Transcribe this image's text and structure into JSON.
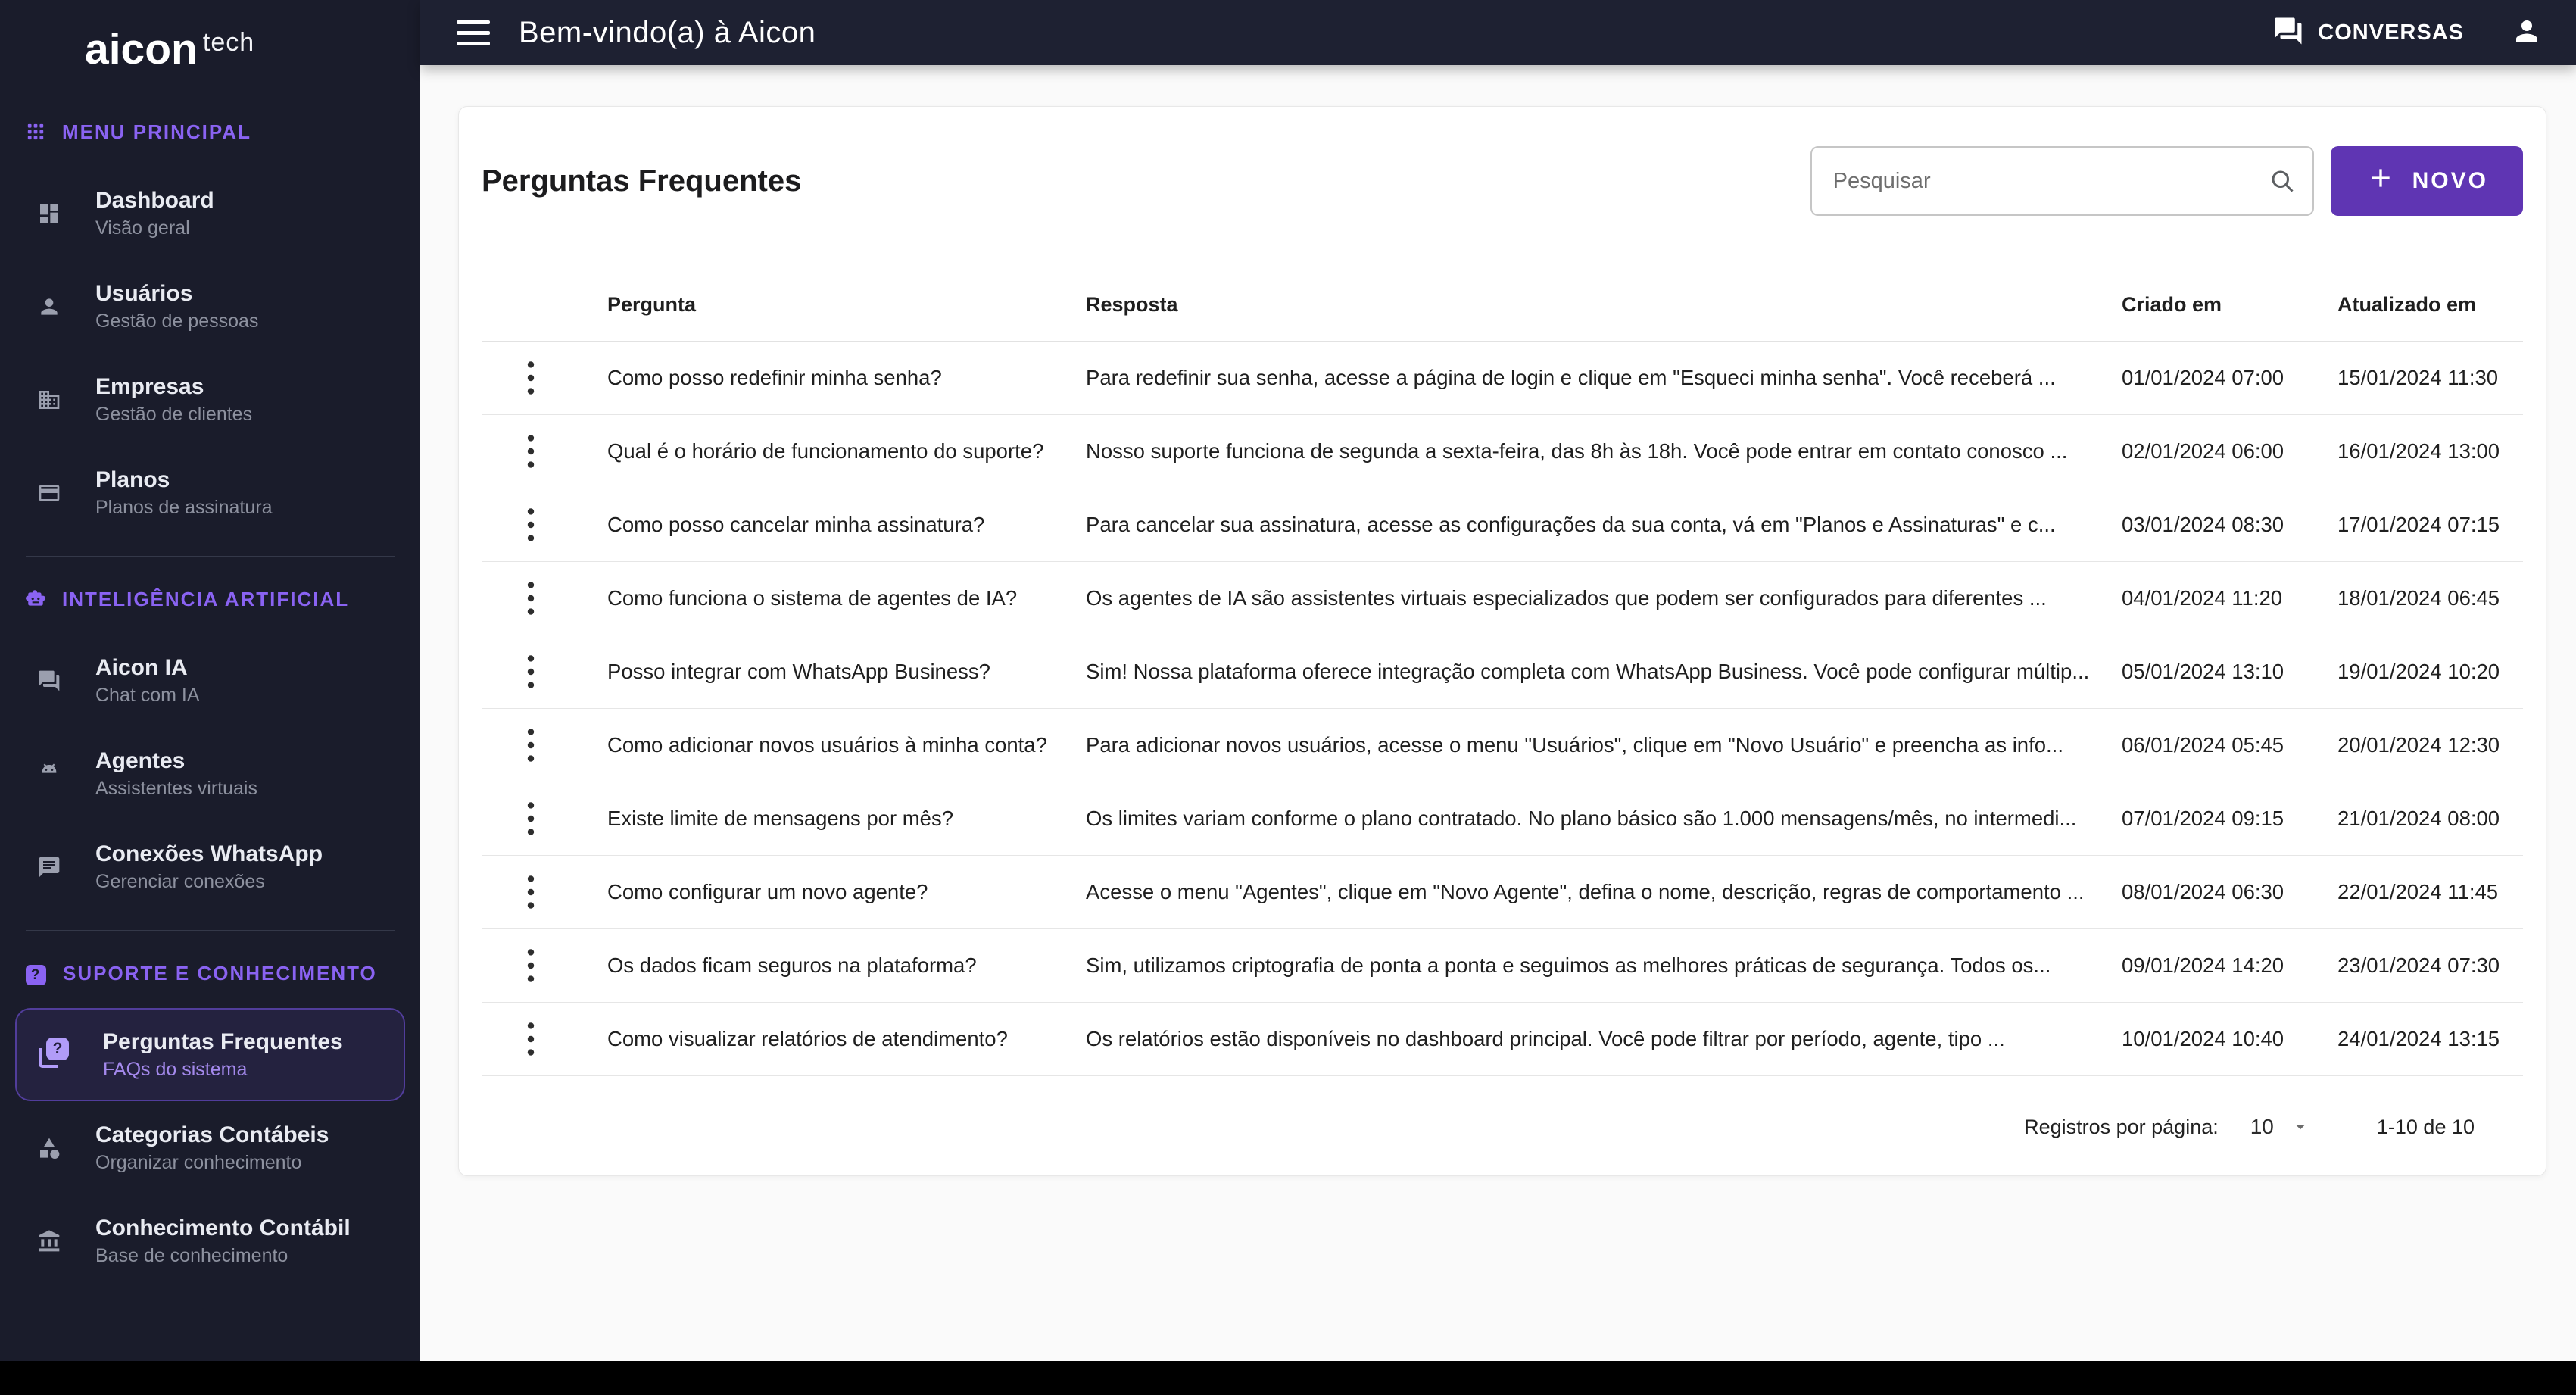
{
  "app": {
    "brand": "aicon",
    "brand_suffix": "tech"
  },
  "topbar": {
    "title": "Bem-vindo(a) à Aicon",
    "conversations_label": "CONVERSAS"
  },
  "sidebar": {
    "sections": [
      {
        "label": "MENU PRINCIPAL",
        "icon": "apps-grid-icon",
        "items": [
          {
            "label": "Dashboard",
            "sublabel": "Visão geral",
            "icon": "dashboard-icon",
            "active": false
          },
          {
            "label": "Usuários",
            "sublabel": "Gestão de pessoas",
            "icon": "person-icon",
            "active": false
          },
          {
            "label": "Empresas",
            "sublabel": "Gestão de clientes",
            "icon": "building-icon",
            "active": false
          },
          {
            "label": "Planos",
            "sublabel": "Planos de assinatura",
            "icon": "credit-card-icon",
            "active": false
          }
        ]
      },
      {
        "label": "INTELIGÊNCIA ARTIFICIAL",
        "icon": "robot-icon",
        "items": [
          {
            "label": "Aicon IA",
            "sublabel": "Chat com IA",
            "icon": "forum-icon",
            "active": false
          },
          {
            "label": "Agentes",
            "sublabel": "Assistentes virtuais",
            "icon": "robot-head-icon",
            "active": false
          },
          {
            "label": "Conexões WhatsApp",
            "sublabel": "Gerenciar conexões",
            "icon": "chat-lines-icon",
            "active": false
          }
        ]
      },
      {
        "label": "SUPORTE E CONHECIMENTO",
        "icon": "question-square-icon",
        "items": [
          {
            "label": "Perguntas Frequentes",
            "sublabel": "FAQs do sistema",
            "icon": "quiz-icon",
            "active": true
          },
          {
            "label": "Categorias Contábeis",
            "sublabel": "Organizar conhecimento",
            "icon": "category-icon",
            "active": false
          },
          {
            "label": "Conhecimento Contábil",
            "sublabel": "Base de conhecimento",
            "icon": "bank-icon",
            "active": false
          }
        ]
      }
    ]
  },
  "main": {
    "page_title": "Perguntas Frequentes",
    "search": {
      "placeholder": "Pesquisar"
    },
    "new_button_label": "NOVO",
    "table": {
      "columns": [
        "",
        "Pergunta",
        "Resposta",
        "Criado em",
        "Atualizado em"
      ],
      "rows": [
        {
          "question": "Como posso redefinir minha senha?",
          "answer": "Para redefinir sua senha, acesse a página de login e clique em \"Esqueci minha senha\". Você receberá ...",
          "created": "01/01/2024 07:00",
          "updated": "15/01/2024 11:30"
        },
        {
          "question": "Qual é o horário de funcionamento do suporte?",
          "answer": "Nosso suporte funciona de segunda a sexta-feira, das 8h às 18h. Você pode entrar em contato conosco ...",
          "created": "02/01/2024 06:00",
          "updated": "16/01/2024 13:00"
        },
        {
          "question": "Como posso cancelar minha assinatura?",
          "answer": "Para cancelar sua assinatura, acesse as configurações da sua conta, vá em \"Planos e Assinaturas\" e c...",
          "created": "03/01/2024 08:30",
          "updated": "17/01/2024 07:15"
        },
        {
          "question": "Como funciona o sistema de agentes de IA?",
          "answer": "Os agentes de IA são assistentes virtuais especializados que podem ser configurados para diferentes ...",
          "created": "04/01/2024 11:20",
          "updated": "18/01/2024 06:45"
        },
        {
          "question": "Posso integrar com WhatsApp Business?",
          "answer": "Sim! Nossa plataforma oferece integração completa com WhatsApp Business. Você pode configurar múltip...",
          "created": "05/01/2024 13:10",
          "updated": "19/01/2024 10:20"
        },
        {
          "question": "Como adicionar novos usuários à minha conta?",
          "answer": "Para adicionar novos usuários, acesse o menu \"Usuários\", clique em \"Novo Usuário\" e preencha as info...",
          "created": "06/01/2024 05:45",
          "updated": "20/01/2024 12:30"
        },
        {
          "question": "Existe limite de mensagens por mês?",
          "answer": "Os limites variam conforme o plano contratado. No plano básico são 1.000 mensagens/mês, no intermedi...",
          "created": "07/01/2024 09:15",
          "updated": "21/01/2024 08:00"
        },
        {
          "question": "Como configurar um novo agente?",
          "answer": "Acesse o menu \"Agentes\", clique em \"Novo Agente\", defina o nome, descrição, regras de comportamento ...",
          "created": "08/01/2024 06:30",
          "updated": "22/01/2024 11:45"
        },
        {
          "question": "Os dados ficam seguros na plataforma?",
          "answer": "Sim, utilizamos criptografia de ponta a ponta e seguimos as melhores práticas de segurança. Todos os...",
          "created": "09/01/2024 14:20",
          "updated": "23/01/2024 07:30"
        },
        {
          "question": "Como visualizar relatórios de atendimento?",
          "answer": "Os relatórios estão disponíveis no dashboard principal. Você pode filtrar por período, agente, tipo ...",
          "created": "10/01/2024 10:40",
          "updated": "24/01/2024 13:15"
        }
      ]
    },
    "pagination": {
      "label": "Registros por página:",
      "per_page": "10",
      "range": "1-10 de 10"
    }
  },
  "colors": {
    "sidebar_bg": "#1a1c2b",
    "topbar_bg": "#1e2132",
    "content_bg": "#fafafa",
    "accent_purple": "#8a63f2",
    "button_purple": "#5f35b3",
    "active_item_icon": "#b19cf8"
  }
}
